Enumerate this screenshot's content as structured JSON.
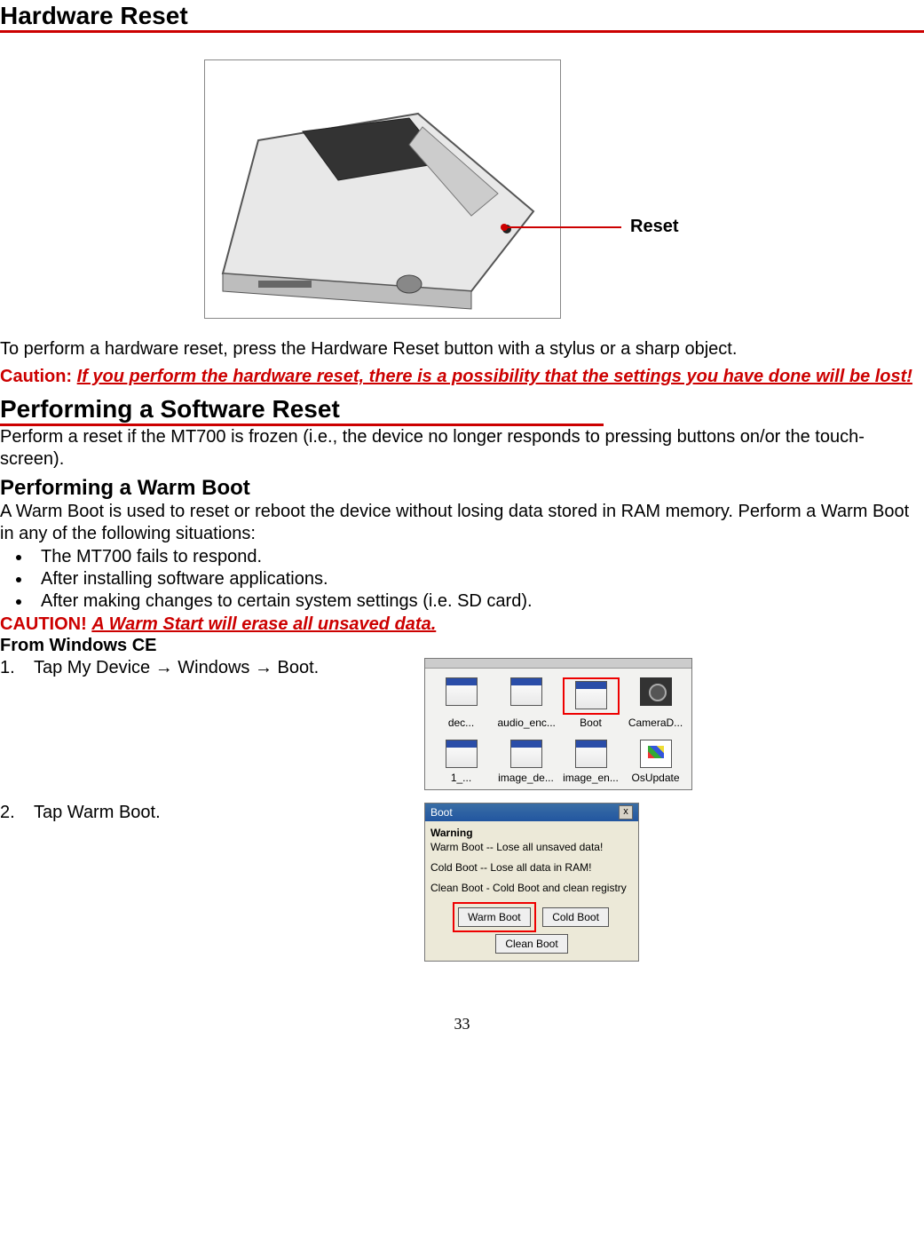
{
  "headings": {
    "hardware_reset": "Hardware Reset",
    "software_reset": "Performing a Software Reset",
    "warm_boot": "Performing a Warm Boot"
  },
  "diagram": {
    "callout": "Reset"
  },
  "hw_reset_intro": "To perform a hardware reset, press the Hardware Reset button with a stylus or a sharp object.",
  "hw_caution": {
    "label": "Caution: ",
    "body": "If you perform the hardware reset, there is a possibility that the settings you have done will be lost!"
  },
  "sw_reset_body": "Perform a reset if the MT700 is frozen (i.e., the device no longer responds to pressing buttons on/or the touch-screen).",
  "warm_body": "A Warm Boot is used to reset or reboot the device without losing data stored in RAM memory. Perform a Warm Boot in any of the following situations:",
  "warm_bullets": [
    "The MT700 fails to respond.",
    "After installing software applications.",
    "After making changes to certain system settings (i.e. SD card)."
  ],
  "warm_caution": {
    "label": "CAUTION! ",
    "body": "A Warm Start will erase all unsaved data."
  },
  "ce_label": "From Windows CE",
  "steps": {
    "s1_num": "1.",
    "s1_txt": "Tap My Device  →  Windows  →  Boot.",
    "s2_num": "2.",
    "s2_txt": "Tap Warm Boot."
  },
  "shot1": {
    "row1_labels": [
      "dec...",
      "audio_enc...",
      "Boot",
      "CameraD..."
    ],
    "row2_labels": [
      "1_...",
      "image_de...",
      "image_en...",
      "OsUpdate"
    ]
  },
  "shot2": {
    "title": "Boot",
    "close": "x",
    "warn_h": "Warning",
    "warn_line1": "Warm Boot -- Lose all unsaved data!",
    "warn_line2": "Cold Boot -- Lose all data in RAM!",
    "warn_line3": "Clean Boot - Cold Boot and clean registry",
    "btn_warm": "Warm Boot",
    "btn_cold": "Cold Boot",
    "btn_clean": "Clean Boot"
  },
  "page_number": "33"
}
